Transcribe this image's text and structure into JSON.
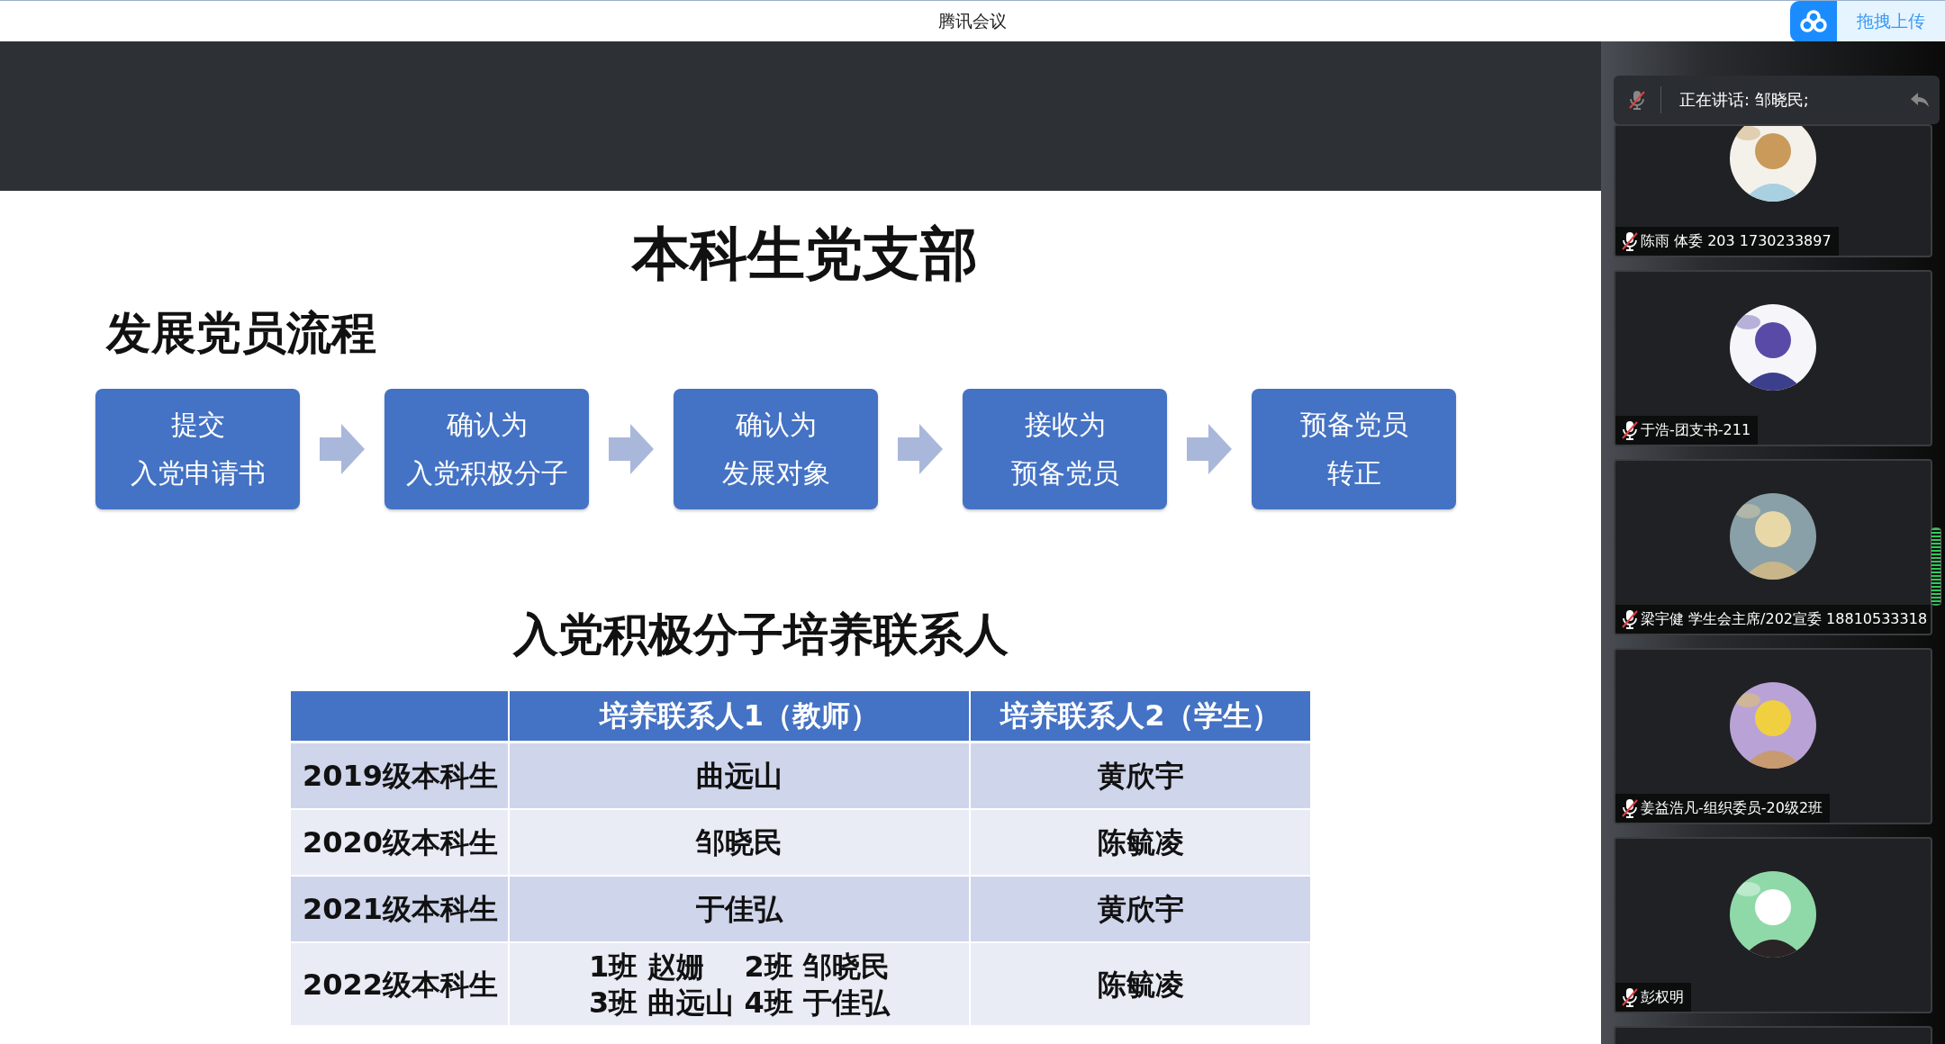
{
  "window": {
    "title": "腾讯会议"
  },
  "upload_button": {
    "label": "拖拽上传"
  },
  "slide": {
    "title": "本科生党支部",
    "subtitle": "发展党员流程",
    "steps": [
      {
        "lines": [
          "提交",
          "入党申请书"
        ]
      },
      {
        "lines": [
          "确认为",
          "入党积极分子"
        ]
      },
      {
        "lines": [
          "确认为",
          "发展对象"
        ]
      },
      {
        "lines": [
          "接收为",
          "预备党员"
        ]
      },
      {
        "lines": [
          "预备党员",
          "转正"
        ]
      }
    ],
    "table_title": "入党积极分子培养联系人",
    "table": {
      "columns": [
        "培养联系人1（教师）",
        "培养联系人2（学生）"
      ],
      "rows": [
        {
          "grade": "2019级本科生",
          "contact_1": [
            "曲远山"
          ],
          "contact_2": "黄欣宇"
        },
        {
          "grade": "2020级本科生",
          "contact_1": [
            "邹晓民"
          ],
          "contact_2": "陈毓凌"
        },
        {
          "grade": "2021级本科生",
          "contact_1": [
            "于佳弘"
          ],
          "contact_2": "黄欣宇"
        },
        {
          "grade": "2022级本科生",
          "contact_1": [
            "1班 赵姗　 2班 邹晓民",
            "3班 曲远山 4班 于佳弘"
          ],
          "contact_2": "陈毓凌"
        }
      ]
    }
  },
  "speaking": {
    "text": "正在讲话: 邹晓民;",
    "muted": true
  },
  "participants": [
    {
      "name": "陈雨 体委 203 1730233897",
      "muted": true
    },
    {
      "name": "于浩-团支书-211",
      "muted": true
    },
    {
      "name": "梁宇健 学生会主席/202宣委 18810533318",
      "muted": true
    },
    {
      "name": "姜益浩凡-组织委员-20级2班",
      "muted": true
    },
    {
      "name": "彭权明",
      "muted": true
    }
  ]
}
